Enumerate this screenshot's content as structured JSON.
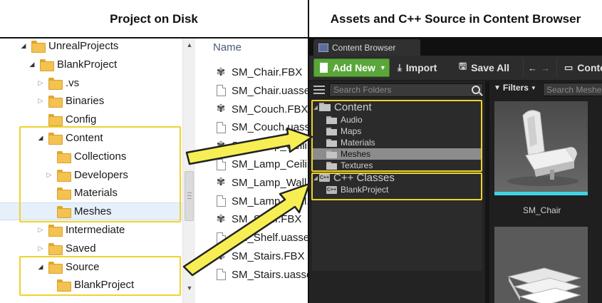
{
  "headers": {
    "left": "Project on Disk",
    "right": "Assets and C++ Source in Content Browser"
  },
  "explorer": {
    "tree": [
      {
        "label": "UnrealProjects",
        "state": "open"
      },
      {
        "label": "BlankProject",
        "state": "open"
      },
      {
        "label": ".vs",
        "state": "closed"
      },
      {
        "label": "Binaries",
        "state": "closed"
      },
      {
        "label": "Config",
        "state": "none"
      },
      {
        "label": "Content",
        "state": "open"
      },
      {
        "label": "Collections",
        "state": "none"
      },
      {
        "label": "Developers",
        "state": "closed"
      },
      {
        "label": "Materials",
        "state": "none"
      },
      {
        "label": "Meshes",
        "state": "none",
        "selected": true
      },
      {
        "label": "Intermediate",
        "state": "closed"
      },
      {
        "label": "Saved",
        "state": "closed"
      },
      {
        "label": "Source",
        "state": "open"
      },
      {
        "label": "BlankProject",
        "state": "none"
      }
    ],
    "column_header": "Name",
    "files": [
      {
        "name": "SM_Chair.FBX",
        "icon": "fbx-icon"
      },
      {
        "name": "SM_Chair.uasset",
        "icon": "document-icon"
      },
      {
        "name": "SM_Couch.FBX",
        "icon": "fbx-icon"
      },
      {
        "name": "SM_Couch.uasset",
        "icon": "document-icon"
      },
      {
        "name": "SM_Lamp_Ceiling.FBX",
        "icon": "fbx-icon"
      },
      {
        "name": "SM_Lamp_Ceiling.uasset",
        "icon": "document-icon"
      },
      {
        "name": "SM_Lamp_Wall.FBX",
        "icon": "fbx-icon"
      },
      {
        "name": "SM_Lamp_Wall.uasset",
        "icon": "document-icon"
      },
      {
        "name": "SM_Shelf.FBX",
        "icon": "fbx-icon"
      },
      {
        "name": "SM_Shelf.uasset",
        "icon": "document-icon"
      },
      {
        "name": "SM_Stairs.FBX",
        "icon": "fbx-icon"
      },
      {
        "name": "SM_Stairs.uasset",
        "icon": "document-icon"
      }
    ]
  },
  "content_browser": {
    "tab_title": "Content Browser",
    "toolbar": {
      "add_new": "Add New",
      "import": "Import",
      "save_all": "Save All",
      "path_root": "Content"
    },
    "search_folders_placeholder": "Search Folders",
    "filters_label": "Filters",
    "search_meshes_placeholder": "Search Meshes",
    "folder_tree": [
      {
        "label": "Content",
        "level": 0,
        "kind": "folder"
      },
      {
        "label": "Audio",
        "level": 1,
        "kind": "folder"
      },
      {
        "label": "Maps",
        "level": 1,
        "kind": "folder"
      },
      {
        "label": "Materials",
        "level": 1,
        "kind": "folder"
      },
      {
        "label": "Meshes",
        "level": 1,
        "kind": "folder",
        "selected": true
      },
      {
        "label": "Textures",
        "level": 1,
        "kind": "folder"
      },
      {
        "label": "C++ Classes",
        "level": 0,
        "kind": "classes"
      },
      {
        "label": "BlankProject",
        "level": 1,
        "kind": "classes"
      }
    ],
    "assets": [
      {
        "label": "SM_Chair"
      },
      {
        "label": ""
      }
    ]
  },
  "colors": {
    "highlight": "#f0d22c",
    "add_new_green": "#5aa63a",
    "thumbnail_stripe": "#3fd3e6",
    "arrow_fill": "#f7ee54"
  }
}
